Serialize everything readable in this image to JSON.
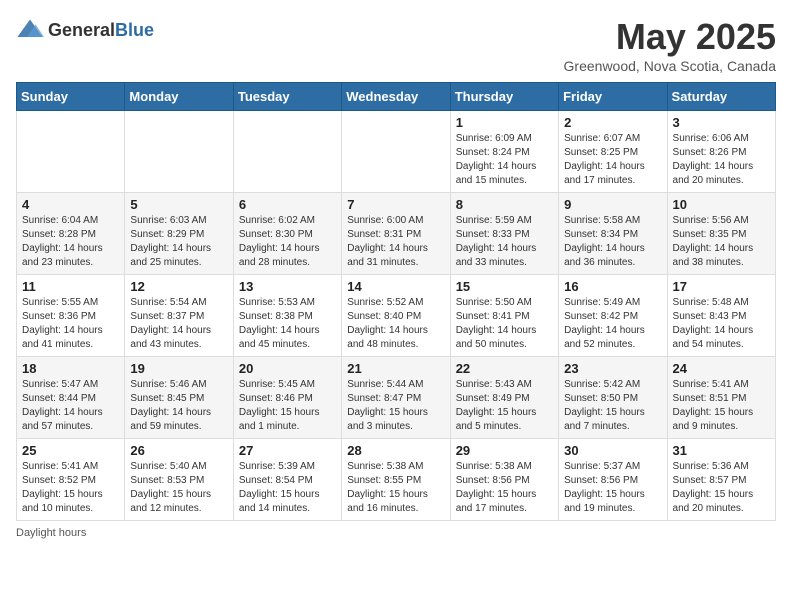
{
  "header": {
    "logo_general": "General",
    "logo_blue": "Blue",
    "month": "May 2025",
    "location": "Greenwood, Nova Scotia, Canada"
  },
  "weekdays": [
    "Sunday",
    "Monday",
    "Tuesday",
    "Wednesday",
    "Thursday",
    "Friday",
    "Saturday"
  ],
  "weeks": [
    [
      {
        "day": "",
        "info": ""
      },
      {
        "day": "",
        "info": ""
      },
      {
        "day": "",
        "info": ""
      },
      {
        "day": "",
        "info": ""
      },
      {
        "day": "1",
        "info": "Sunrise: 6:09 AM\nSunset: 8:24 PM\nDaylight: 14 hours\nand 15 minutes."
      },
      {
        "day": "2",
        "info": "Sunrise: 6:07 AM\nSunset: 8:25 PM\nDaylight: 14 hours\nand 17 minutes."
      },
      {
        "day": "3",
        "info": "Sunrise: 6:06 AM\nSunset: 8:26 PM\nDaylight: 14 hours\nand 20 minutes."
      }
    ],
    [
      {
        "day": "4",
        "info": "Sunrise: 6:04 AM\nSunset: 8:28 PM\nDaylight: 14 hours\nand 23 minutes."
      },
      {
        "day": "5",
        "info": "Sunrise: 6:03 AM\nSunset: 8:29 PM\nDaylight: 14 hours\nand 25 minutes."
      },
      {
        "day": "6",
        "info": "Sunrise: 6:02 AM\nSunset: 8:30 PM\nDaylight: 14 hours\nand 28 minutes."
      },
      {
        "day": "7",
        "info": "Sunrise: 6:00 AM\nSunset: 8:31 PM\nDaylight: 14 hours\nand 31 minutes."
      },
      {
        "day": "8",
        "info": "Sunrise: 5:59 AM\nSunset: 8:33 PM\nDaylight: 14 hours\nand 33 minutes."
      },
      {
        "day": "9",
        "info": "Sunrise: 5:58 AM\nSunset: 8:34 PM\nDaylight: 14 hours\nand 36 minutes."
      },
      {
        "day": "10",
        "info": "Sunrise: 5:56 AM\nSunset: 8:35 PM\nDaylight: 14 hours\nand 38 minutes."
      }
    ],
    [
      {
        "day": "11",
        "info": "Sunrise: 5:55 AM\nSunset: 8:36 PM\nDaylight: 14 hours\nand 41 minutes."
      },
      {
        "day": "12",
        "info": "Sunrise: 5:54 AM\nSunset: 8:37 PM\nDaylight: 14 hours\nand 43 minutes."
      },
      {
        "day": "13",
        "info": "Sunrise: 5:53 AM\nSunset: 8:38 PM\nDaylight: 14 hours\nand 45 minutes."
      },
      {
        "day": "14",
        "info": "Sunrise: 5:52 AM\nSunset: 8:40 PM\nDaylight: 14 hours\nand 48 minutes."
      },
      {
        "day": "15",
        "info": "Sunrise: 5:50 AM\nSunset: 8:41 PM\nDaylight: 14 hours\nand 50 minutes."
      },
      {
        "day": "16",
        "info": "Sunrise: 5:49 AM\nSunset: 8:42 PM\nDaylight: 14 hours\nand 52 minutes."
      },
      {
        "day": "17",
        "info": "Sunrise: 5:48 AM\nSunset: 8:43 PM\nDaylight: 14 hours\nand 54 minutes."
      }
    ],
    [
      {
        "day": "18",
        "info": "Sunrise: 5:47 AM\nSunset: 8:44 PM\nDaylight: 14 hours\nand 57 minutes."
      },
      {
        "day": "19",
        "info": "Sunrise: 5:46 AM\nSunset: 8:45 PM\nDaylight: 14 hours\nand 59 minutes."
      },
      {
        "day": "20",
        "info": "Sunrise: 5:45 AM\nSunset: 8:46 PM\nDaylight: 15 hours\nand 1 minute."
      },
      {
        "day": "21",
        "info": "Sunrise: 5:44 AM\nSunset: 8:47 PM\nDaylight: 15 hours\nand 3 minutes."
      },
      {
        "day": "22",
        "info": "Sunrise: 5:43 AM\nSunset: 8:49 PM\nDaylight: 15 hours\nand 5 minutes."
      },
      {
        "day": "23",
        "info": "Sunrise: 5:42 AM\nSunset: 8:50 PM\nDaylight: 15 hours\nand 7 minutes."
      },
      {
        "day": "24",
        "info": "Sunrise: 5:41 AM\nSunset: 8:51 PM\nDaylight: 15 hours\nand 9 minutes."
      }
    ],
    [
      {
        "day": "25",
        "info": "Sunrise: 5:41 AM\nSunset: 8:52 PM\nDaylight: 15 hours\nand 10 minutes."
      },
      {
        "day": "26",
        "info": "Sunrise: 5:40 AM\nSunset: 8:53 PM\nDaylight: 15 hours\nand 12 minutes."
      },
      {
        "day": "27",
        "info": "Sunrise: 5:39 AM\nSunset: 8:54 PM\nDaylight: 15 hours\nand 14 minutes."
      },
      {
        "day": "28",
        "info": "Sunrise: 5:38 AM\nSunset: 8:55 PM\nDaylight: 15 hours\nand 16 minutes."
      },
      {
        "day": "29",
        "info": "Sunrise: 5:38 AM\nSunset: 8:56 PM\nDaylight: 15 hours\nand 17 minutes."
      },
      {
        "day": "30",
        "info": "Sunrise: 5:37 AM\nSunset: 8:56 PM\nDaylight: 15 hours\nand 19 minutes."
      },
      {
        "day": "31",
        "info": "Sunrise: 5:36 AM\nSunset: 8:57 PM\nDaylight: 15 hours\nand 20 minutes."
      }
    ]
  ],
  "footer": "Daylight hours"
}
